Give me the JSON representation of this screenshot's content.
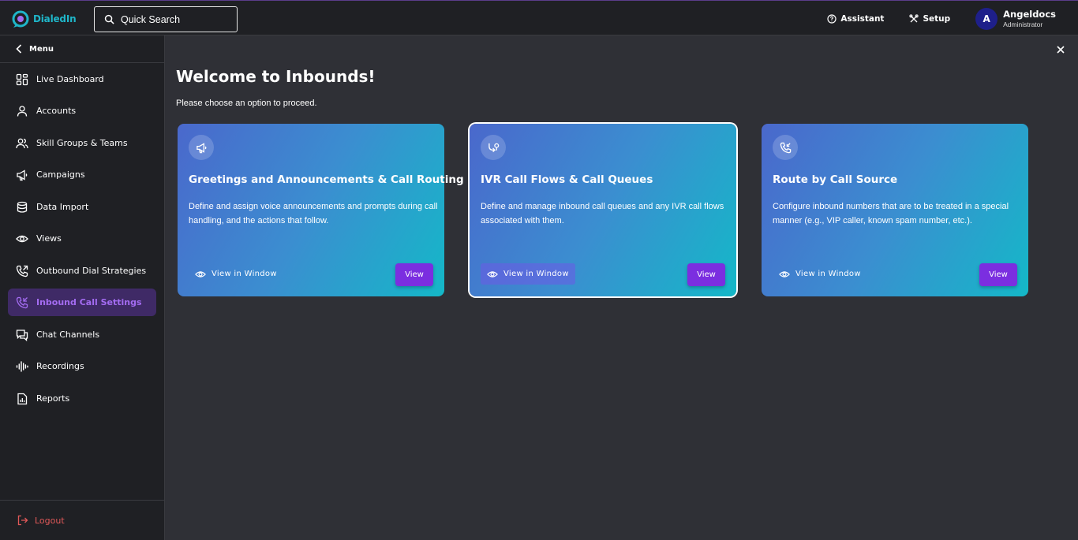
{
  "app": {
    "brand": "DialedIn"
  },
  "search": {
    "placeholder": "Quick Search"
  },
  "topbar": {
    "assistant_label": "Assistant",
    "setup_label": "Setup",
    "user": {
      "initial": "A",
      "name": "Angeldocs",
      "role": "Administrator"
    }
  },
  "sidebar": {
    "menu_label": "Menu",
    "items": [
      {
        "label": "Live Dashboard",
        "icon": "dashboard-icon"
      },
      {
        "label": "Accounts",
        "icon": "user-icon"
      },
      {
        "label": "Skill Groups & Teams",
        "icon": "users-icon"
      },
      {
        "label": "Campaigns",
        "icon": "megaphone-icon"
      },
      {
        "label": "Data Import",
        "icon": "database-icon"
      },
      {
        "label": "Views",
        "icon": "eye-icon"
      },
      {
        "label": "Outbound Dial Strategies",
        "icon": "phone-outgoing-icon"
      },
      {
        "label": "Inbound Call Settings",
        "icon": "phone-incoming-icon",
        "active": true
      },
      {
        "label": "Chat Channels",
        "icon": "chat-icon"
      },
      {
        "label": "Recordings",
        "icon": "waveform-icon"
      },
      {
        "label": "Reports",
        "icon": "report-icon"
      }
    ],
    "logout_label": "Logout"
  },
  "main": {
    "title": "Welcome to Inbounds!",
    "subtitle": "Please choose an option to proceed.",
    "cards": [
      {
        "title": "Greetings and Announcements & Call Routing",
        "description": "Define and assign voice announcements and prompts during call handling, and the actions that follow.",
        "view_window_label": "View in Window",
        "view_label": "View",
        "icon": "megaphone-icon"
      },
      {
        "title": "IVR Call Flows & Call Queues",
        "description": "Define and manage inbound call queues and any IVR call flows associated with them.",
        "view_window_label": "View in Window",
        "view_label": "View",
        "icon": "ivr-flow-icon",
        "selected": true
      },
      {
        "title": "Route by Call Source",
        "description": "Configure inbound numbers that are to be treated in a special manner (e.g., VIP caller, known spam number, etc.).",
        "view_window_label": "View in Window",
        "view_label": "View",
        "icon": "phone-route-icon"
      }
    ]
  },
  "colors": {
    "accent": "#7b2ee0",
    "active_nav_bg": "#3f2a66",
    "active_nav_text": "#a46cf2",
    "logout": "#e05858",
    "brand": "#1fb6c9"
  }
}
